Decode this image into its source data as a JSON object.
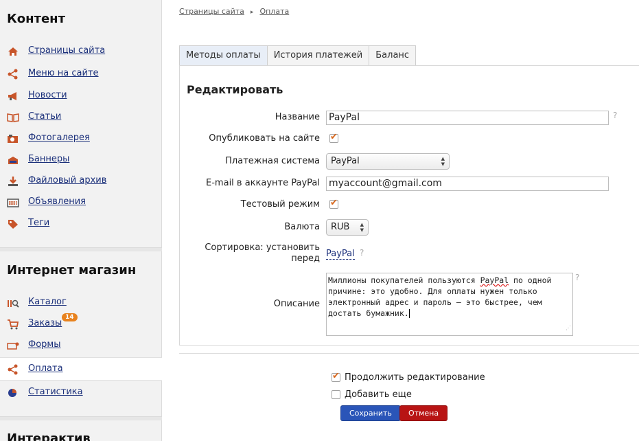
{
  "sidebar": {
    "sections": [
      {
        "title": "Контент"
      },
      {
        "title": "Интернет магазин"
      },
      {
        "title": "Интерактив"
      }
    ],
    "items": [
      {
        "label": "Страницы сайта",
        "icon": "home-icon"
      },
      {
        "label": "Меню на сайте",
        "icon": "share-icon"
      },
      {
        "label": "Новости",
        "icon": "megaphone-icon"
      },
      {
        "label": "Статьи",
        "icon": "book-icon"
      },
      {
        "label": "Фотогалерея",
        "icon": "photo-icon"
      },
      {
        "label": "Баннеры",
        "icon": "banner-icon"
      },
      {
        "label": "Файловый архив",
        "icon": "download-icon"
      },
      {
        "label": "Объявления",
        "icon": "board-icon"
      },
      {
        "label": "Теги",
        "icon": "tag-icon"
      },
      {
        "label": "Каталог",
        "icon": "catalog-icon"
      },
      {
        "label": "Заказы",
        "icon": "cart-icon",
        "badge": "14"
      },
      {
        "label": "Формы",
        "icon": "form-icon"
      },
      {
        "label": "Оплата",
        "icon": "share-icon",
        "active": true
      },
      {
        "label": "Статистика",
        "icon": "pie-chart-icon"
      }
    ]
  },
  "breadcrumb": {
    "items": [
      "Страницы сайта",
      "Оплата"
    ],
    "separator": "▸"
  },
  "tabs": [
    {
      "label": "Методы оплаты",
      "active": true
    },
    {
      "label": "История платежей"
    },
    {
      "label": "Баланс"
    }
  ],
  "form": {
    "title": "Редактировать",
    "name_label": "Название",
    "name_value": "PayPal",
    "publish_label": "Опубликовать на сайте",
    "publish_checked": true,
    "system_label": "Платежная система",
    "system_value": "PayPal",
    "email_label": "E-mail в аккаунте PayPal",
    "email_value": "myaccount@gmail.com",
    "test_label": "Тестовый режим",
    "test_checked": true,
    "currency_label": "Валюта",
    "currency_value": "RUB",
    "sort_label_1": "Сортировка: установить",
    "sort_label_2": "перед",
    "sort_value": "PayPal",
    "description_label": "Описание",
    "description_value_pre": "Миллионы покупателей пользуются ",
    "description_spell": "PayPal",
    "description_value_post": " по одной причине: это удобно. Для оплаты нужен только электронный адрес и пароль — это быстрее, чем достать бумажник.",
    "help_mark": "?"
  },
  "options": {
    "continue_label": "Продолжить редактирование",
    "continue_checked": true,
    "add_more_label": "Добавить еще",
    "add_more_checked": false
  },
  "buttons": {
    "save": "Сохранить",
    "cancel": "Отмена"
  },
  "colors": {
    "link": "#1a2f7a",
    "check": "#d8661a",
    "save": "#2a55b8",
    "cancel": "#b81414",
    "badge": "#e8821e"
  }
}
